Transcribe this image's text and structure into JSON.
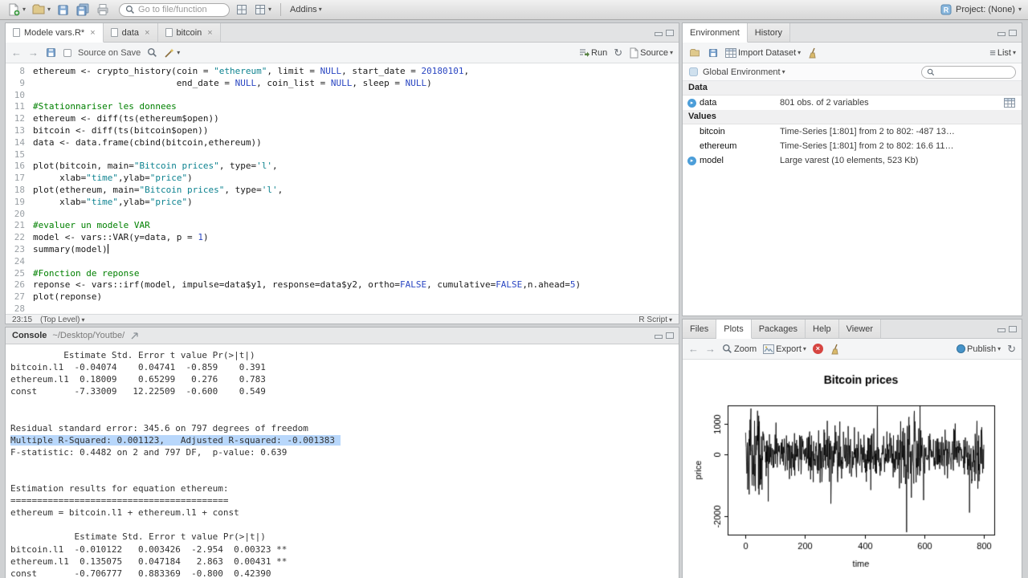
{
  "icons": {
    "caret": "▾",
    "close": "×",
    "back": "←",
    "forward": "→",
    "refresh": "↻",
    "list": "≡",
    "expand": "▸",
    "popout": "⇲"
  },
  "toolbar": {
    "goto_placeholder": "Go to file/function",
    "addins": "Addins",
    "project": "Project: (None)"
  },
  "source": {
    "tabs": [
      {
        "label": "Modele vars.R*",
        "active": true
      },
      {
        "label": "data",
        "active": false
      },
      {
        "label": "bitcoin",
        "active": false
      }
    ],
    "toolbar": {
      "source_on_save": "Source on Save",
      "run": "Run",
      "source": "Source"
    },
    "status": {
      "cursor": "23:15",
      "scope": "(Top Level)",
      "type": "R Script"
    },
    "code_lines": [
      {
        "n": 8,
        "seg": [
          [
            "p",
            "ethereum <- crypto_history(coin = "
          ],
          [
            "s",
            "\"ethereum\""
          ],
          [
            "p",
            ", limit = "
          ],
          [
            "k",
            "NULL"
          ],
          [
            "p",
            ", start_date = "
          ],
          [
            "num",
            "20180101"
          ],
          [
            "p",
            ","
          ]
        ]
      },
      {
        "n": 9,
        "seg": [
          [
            "p",
            "                           end_date = "
          ],
          [
            "k",
            "NULL"
          ],
          [
            "p",
            ", coin_list = "
          ],
          [
            "k",
            "NULL"
          ],
          [
            "p",
            ", sleep = "
          ],
          [
            "k",
            "NULL"
          ],
          [
            "p",
            ")"
          ]
        ]
      },
      {
        "n": 10,
        "seg": []
      },
      {
        "n": 11,
        "seg": [
          [
            "c",
            "#Stationnariser les donnees"
          ]
        ]
      },
      {
        "n": 12,
        "seg": [
          [
            "p",
            "ethereum <- diff(ts(ethereum$open))"
          ]
        ]
      },
      {
        "n": 13,
        "seg": [
          [
            "p",
            "bitcoin <- diff(ts(bitcoin$open))"
          ]
        ]
      },
      {
        "n": 14,
        "seg": [
          [
            "p",
            "data <- data.frame(cbind(bitcoin,ethereum))"
          ]
        ]
      },
      {
        "n": 15,
        "seg": []
      },
      {
        "n": 16,
        "seg": [
          [
            "p",
            "plot(bitcoin, main="
          ],
          [
            "s",
            "\"Bitcoin prices\""
          ],
          [
            "p",
            ", type="
          ],
          [
            "s",
            "'l'"
          ],
          [
            "p",
            ","
          ]
        ]
      },
      {
        "n": 17,
        "seg": [
          [
            "p",
            "     xlab="
          ],
          [
            "s",
            "\"time\""
          ],
          [
            "p",
            ",ylab="
          ],
          [
            "s",
            "\"price\""
          ],
          [
            "p",
            ")"
          ]
        ]
      },
      {
        "n": 18,
        "seg": [
          [
            "p",
            "plot(ethereum, main="
          ],
          [
            "s",
            "\"Bitcoin prices\""
          ],
          [
            "p",
            ", type="
          ],
          [
            "s",
            "'l'"
          ],
          [
            "p",
            ","
          ]
        ]
      },
      {
        "n": 19,
        "seg": [
          [
            "p",
            "     xlab="
          ],
          [
            "s",
            "\"time\""
          ],
          [
            "p",
            ",ylab="
          ],
          [
            "s",
            "\"price\""
          ],
          [
            "p",
            ")"
          ]
        ]
      },
      {
        "n": 20,
        "seg": []
      },
      {
        "n": 21,
        "seg": [
          [
            "c",
            "#evaluer un modele VAR"
          ]
        ]
      },
      {
        "n": 22,
        "seg": [
          [
            "p",
            "model <- vars::VAR(y=data, p = "
          ],
          [
            "num",
            "1"
          ],
          [
            "p",
            ")"
          ]
        ]
      },
      {
        "n": 23,
        "seg": [
          [
            "p",
            "summary(model)"
          ]
        ],
        "caret": true
      },
      {
        "n": 24,
        "seg": []
      },
      {
        "n": 25,
        "seg": [
          [
            "c",
            "#Fonction de reponse"
          ]
        ]
      },
      {
        "n": 26,
        "seg": [
          [
            "p",
            "reponse <- vars::irf(model, impulse=data$y1, response=data$y2, ortho="
          ],
          [
            "k",
            "FALSE"
          ],
          [
            "p",
            ", cumulative="
          ],
          [
            "k",
            "FALSE"
          ],
          [
            "p",
            ",n.ahead="
          ],
          [
            "num",
            "5"
          ],
          [
            "p",
            ")"
          ]
        ]
      },
      {
        "n": 27,
        "seg": [
          [
            "p",
            "plot(reponse)"
          ]
        ]
      },
      {
        "n": 28,
        "seg": []
      }
    ]
  },
  "console": {
    "title": "Console",
    "path": "~/Desktop/Youtbe/",
    "highlight_index": 7,
    "lines": [
      "          Estimate Std. Error t value Pr(>|t|)",
      "bitcoin.l1  -0.04074    0.04741  -0.859    0.391",
      "ethereum.l1  0.18009    0.65299   0.276    0.783",
      "const       -7.33009   12.22509  -0.600    0.549",
      "",
      "",
      "Residual standard error: 345.6 on 797 degrees of freedom",
      "Multiple R-Squared: 0.001123,   Adjusted R-squared: -0.001383 ",
      "F-statistic: 0.4482 on 2 and 797 DF,  p-value: 0.639",
      "",
      "",
      "Estimation results for equation ethereum:",
      "=========================================",
      "ethereum = bitcoin.l1 + ethereum.l1 + const",
      "",
      "            Estimate Std. Error t value Pr(>|t|)",
      "bitcoin.l1  -0.010122   0.003426  -2.954  0.00323 **",
      "ethereum.l1  0.135075   0.047184   2.863  0.00431 **",
      "const       -0.706777   0.883369  -0.800  0.42390"
    ]
  },
  "environment": {
    "tabs": [
      {
        "label": "Environment",
        "active": true
      },
      {
        "label": "History",
        "active": false
      }
    ],
    "toolbar": {
      "import_label": "Import Dataset",
      "list_label": "List"
    },
    "scope": "Global Environment",
    "sections": [
      {
        "title": "Data",
        "rows": [
          {
            "name": "data",
            "value": "801 obs. of 2 variables",
            "expandable": true,
            "grid_icon": true
          }
        ]
      },
      {
        "title": "Values",
        "rows": [
          {
            "name": "bitcoin",
            "value": "Time-Series [1:801] from 2 to 802: -487 13…"
          },
          {
            "name": "ethereum",
            "value": "Time-Series [1:801] from 2 to 802: 16.6 11…"
          },
          {
            "name": "model",
            "value": "Large varest (10 elements, 523 Kb)",
            "expandable": true
          }
        ]
      }
    ]
  },
  "plots": {
    "tabs": [
      {
        "label": "Files",
        "active": false
      },
      {
        "label": "Plots",
        "active": true
      },
      {
        "label": "Packages",
        "active": false
      },
      {
        "label": "Help",
        "active": false
      },
      {
        "label": "Viewer",
        "active": false
      }
    ],
    "toolbar": {
      "zoom": "Zoom",
      "export": "Export",
      "publish": "Publish"
    }
  },
  "chart_data": {
    "type": "line",
    "title": "Bitcoin prices",
    "xlabel": "time",
    "ylabel": "price",
    "xlim": [
      0,
      800
    ],
    "ylim": [
      -2600,
      1600
    ],
    "xticks": [
      0,
      200,
      400,
      600,
      800
    ],
    "yticks": [
      -2000,
      0,
      1000
    ],
    "n_points": 800,
    "line_color": "#000000",
    "description": "Differenced bitcoin open prices: noise around 0 (sd ~345), high volatility at start, large negative spike ~-2500 near x=545",
    "gen": {
      "seed": 42,
      "sd": 345,
      "spikes": [
        [
          18,
          1500
        ],
        [
          22,
          -1000
        ],
        [
          30,
          1100
        ],
        [
          45,
          -1300
        ],
        [
          300,
          950
        ],
        [
          420,
          -1150
        ],
        [
          540,
          -2520
        ],
        [
          547,
          1150
        ],
        [
          556,
          -1400
        ],
        [
          565,
          1250
        ],
        [
          572,
          -900
        ],
        [
          700,
          800
        ],
        [
          760,
          -850
        ]
      ],
      "vol_segments": [
        [
          0,
          60,
          2.1
        ],
        [
          250,
          330,
          1.35
        ],
        [
          520,
          600,
          1.8
        ],
        [
          740,
          800,
          1.3
        ]
      ]
    }
  }
}
